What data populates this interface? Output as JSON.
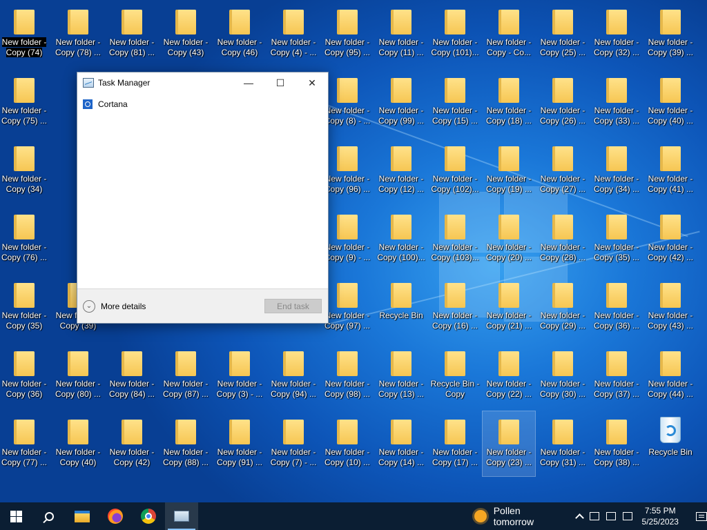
{
  "desktop": {
    "icons": [
      [
        "New folder - Copy (74)",
        "New folder - Copy (78) ...",
        "New folder - Copy (81) ...",
        "New folder - Copy (43)",
        "New folder - Copy (46)",
        "New folder - Copy (4) - ...",
        "New folder - Copy (95) ...",
        "New folder - Copy (11) ...",
        "New folder - Copy (101)...",
        "New folder - Copy - Co...",
        "New folder - Copy (25) ...",
        "New folder - Copy (32) ...",
        "New folder - Copy (39) ..."
      ],
      [
        "New folder - Copy (75) ...",
        "",
        "",
        "",
        "",
        "",
        "New folder - Copy (8) - ...",
        "New folder - Copy (99) ...",
        "New folder - Copy (15) ...",
        "New folder - Copy (18) ...",
        "New folder - Copy (26) ...",
        "New folder - Copy (33) ...",
        "New folder - Copy (40) ..."
      ],
      [
        "New folder - Copy (34)",
        "",
        "",
        "",
        "",
        "",
        "New folder - Copy (96) ...",
        "New folder - Copy (12) ...",
        "New folder - Copy (102)...",
        "New folder - Copy (19) ...",
        "New folder - Copy (27) ...",
        "New folder - Copy (34) ...",
        "New folder - Copy (41) ..."
      ],
      [
        "New folder - Copy (76) ...",
        "",
        "",
        "",
        "",
        "",
        "New folder - Copy (9) - ...",
        "New folder - Copy (100)...",
        "New folder - Copy (103)...",
        "New folder - Copy (20) ...",
        "New folder - Copy (28) ...",
        "New folder - Copy (35) ...",
        "New folder - Copy (42) ..."
      ],
      [
        "New folder - Copy (35)",
        "New folder - Copy (39)",
        "",
        "Copy (45)",
        "Copy (90) ...",
        "Copy (6) - ...",
        "New folder - Copy (97) ...",
        "Recycle Bin",
        "New folder - Copy (16) ...",
        "New folder - Copy (21) ...",
        "New folder - Copy (29) ...",
        "New folder - Copy (36) ...",
        "New folder - Copy (43) ..."
      ],
      [
        "New folder - Copy (36)",
        "New folder - Copy (80) ...",
        "New folder - Copy (84) ...",
        "New folder - Copy (87) ...",
        "New folder - Copy (3) - ...",
        "New folder - Copy (94) ...",
        "New folder - Copy (98) ...",
        "New folder - Copy (13) ...",
        "Recycle Bin - Copy",
        "New folder - Copy (22) ...",
        "New folder - Copy (30) ...",
        "New folder - Copy (37) ...",
        "New folder - Copy (44) ..."
      ],
      [
        "New folder - Copy (77) ...",
        "New folder - Copy (40)",
        "New folder - Copy (42)",
        "New folder - Copy (88) ...",
        "New folder - Copy (91) ...",
        "New folder - Copy (7) - ...",
        "New folder - Copy (10) ...",
        "New folder - Copy (14) ...",
        "New folder - Copy (17) ...",
        "New folder - Copy (23) ...",
        "New folder - Copy (31) ...",
        "New folder - Copy (38) ...",
        "Recycle Bin"
      ]
    ],
    "selected_icon": "New folder - Copy (74)",
    "hovered_icon": "New folder - Copy (23) ..."
  },
  "task_manager": {
    "title": "Task Manager",
    "minimize": "—",
    "maximize": "☐",
    "close": "✕",
    "processes": [
      "Cortana"
    ],
    "more_details": "More details",
    "end_task": "End task"
  },
  "taskbar": {
    "weather": "Pollen tomorrow",
    "time": "7:55 PM",
    "date": "5/25/2023"
  }
}
